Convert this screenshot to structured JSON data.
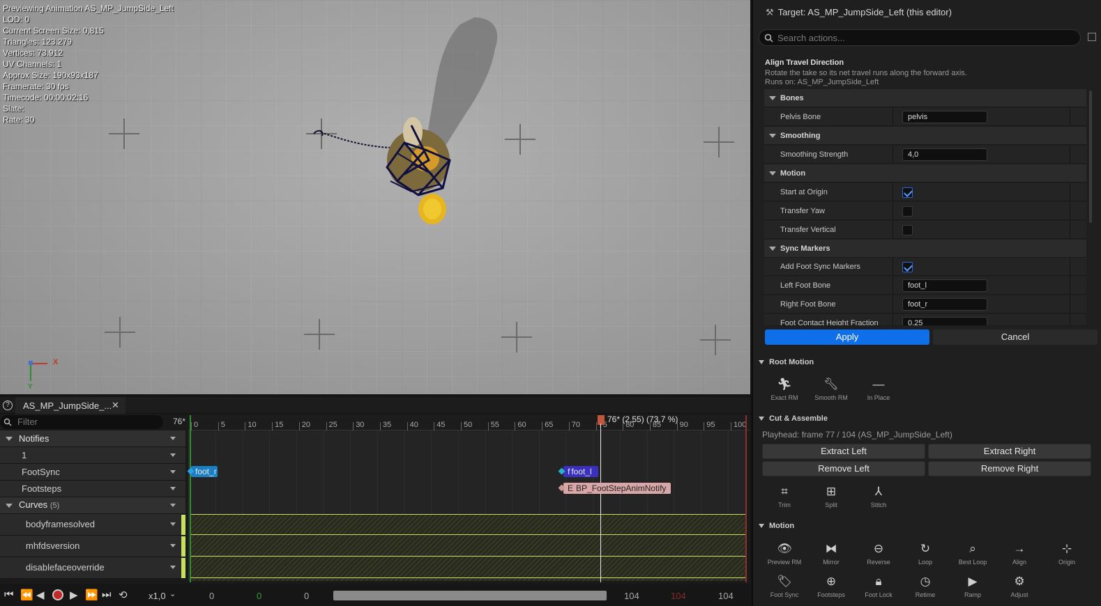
{
  "viewport": {
    "stats": [
      "Previewing Animation AS_MP_JumpSide_Left",
      "LOD: 0",
      "Current Screen Size: 0,815",
      "Triangles: 123.279",
      "Vertices: 73.912",
      "UV Channels: 1",
      "Approx Size: 190x93x187",
      "Framerate: 30 fps",
      "Timecode: 00:00:02:16",
      "Slate:",
      "Rate: 30"
    ],
    "axis_x": "X",
    "axis_y": "Y"
  },
  "panel": {
    "target": "Target: AS_MP_JumpSide_Left (this editor)",
    "search_placeholder": "Search actions...",
    "action_title": "Align Travel Direction",
    "action_desc": "Rotate the take so its net travel runs along the forward axis.",
    "action_runs_on": "Runs on: AS_MP_JumpSide_Left",
    "groups": {
      "bones": "Bones",
      "smoothing": "Smoothing",
      "motion": "Motion",
      "sync": "Sync Markers"
    },
    "props": {
      "pelvis_label": "Pelvis Bone",
      "pelvis_value": "pelvis",
      "smooth_label": "Smoothing Strength",
      "smooth_value": "4,0",
      "start_origin_label": "Start at Origin",
      "start_origin_checked": true,
      "transfer_yaw_label": "Transfer Yaw",
      "transfer_yaw_checked": false,
      "transfer_vert_label": "Transfer Vertical",
      "transfer_vert_checked": false,
      "add_sync_label": "Add Foot Sync Markers",
      "add_sync_checked": true,
      "left_foot_label": "Left Foot Bone",
      "left_foot_value": "foot_l",
      "right_foot_label": "Right Foot Bone",
      "right_foot_value": "foot_r",
      "contact_label": "Foot Contact Height Fraction",
      "contact_value": "0,25"
    },
    "apply": "Apply",
    "cancel": "Cancel",
    "root_motion": {
      "title": "Root Motion",
      "tools": [
        "Exact RM",
        "Smooth RM",
        "In Place"
      ]
    },
    "cut": {
      "title": "Cut & Assemble",
      "playhead": "Playhead: frame 77 / 104  (AS_MP_JumpSide_Left)",
      "extract_left": "Extract Left",
      "extract_right": "Extract Right",
      "remove_left": "Remove Left",
      "remove_right": "Remove Right",
      "tools": [
        "Trim",
        "Split",
        "Stitch"
      ]
    },
    "motion": {
      "title": "Motion",
      "tools_row1": [
        "Preview RM",
        "Mirror",
        "Reverse",
        "Loop",
        "Best Loop",
        "Align",
        "Origin"
      ],
      "tools_row2": [
        "Foot Sync",
        "Footsteps",
        "Foot Lock",
        "Retime",
        "Ramp",
        "Adjust"
      ]
    }
  },
  "timeline": {
    "tab": "AS_MP_JumpSide_...",
    "filter_placeholder": "Filter",
    "frame_box": "76*",
    "ticks": [
      "0",
      "5",
      "10",
      "15",
      "20",
      "25",
      "30",
      "35",
      "40",
      "45",
      "50",
      "55",
      "60",
      "65",
      "70",
      "75",
      "80",
      "85",
      "90",
      "95",
      "100"
    ],
    "playhead_label": "76* (2,55) (73,7 %)",
    "tracks": {
      "notifies": "Notifies",
      "one": "1",
      "footsync": "FootSync",
      "footsteps": "Footsteps",
      "curves": "Curves",
      "curves_count": "(5)",
      "c1": "bodyframesolved",
      "c2": "mhfdsversion",
      "c3": "disablefaceoverride"
    },
    "notifs": {
      "foot_r": "foot_r",
      "foot_l": "foot_l",
      "bp": "BP_FootStepAnimNotify",
      "f": "f",
      "e": "E"
    },
    "playback": {
      "speed": "x1,0",
      "range_start": "0",
      "range_start2": "0",
      "range_start3": "0",
      "range_end": "104",
      "range_end2": "104",
      "range_end3": "104"
    }
  }
}
